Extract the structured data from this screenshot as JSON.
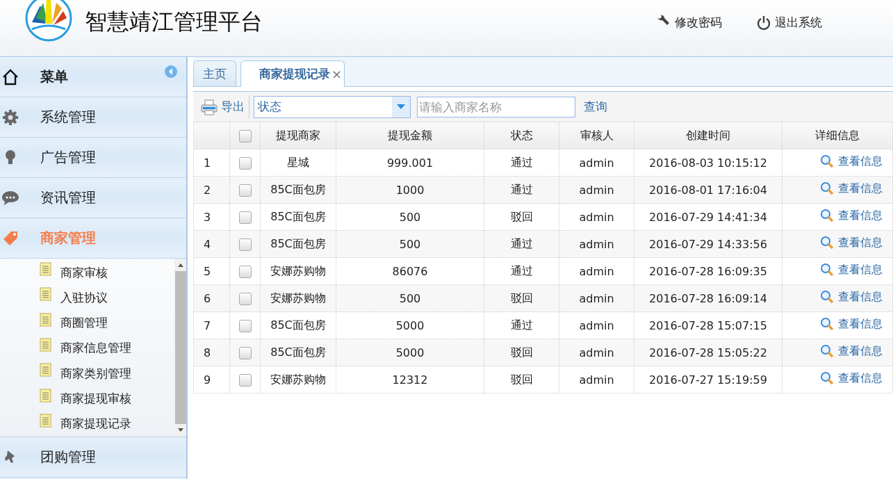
{
  "header": {
    "title": "智慧靖江管理平台",
    "actions": [
      {
        "kind": "password",
        "label": "修改密码"
      },
      {
        "kind": "logout",
        "label": "退出系统"
      }
    ]
  },
  "sidebar": {
    "title": "菜单",
    "items": [
      {
        "kind": "gear",
        "label": "系统管理",
        "selected": false
      },
      {
        "kind": "bulb",
        "label": "广告管理",
        "selected": false
      },
      {
        "kind": "chat",
        "label": "资讯管理",
        "selected": false
      },
      {
        "kind": "tag",
        "label": "商家管理",
        "selected": true,
        "children": [
          {
            "label": "商家审核"
          },
          {
            "label": "入驻协议"
          },
          {
            "label": "商圈管理"
          },
          {
            "label": "商家信息管理"
          },
          {
            "label": "商家类别管理"
          },
          {
            "label": "商家提现审核"
          },
          {
            "label": "商家提现记录"
          }
        ]
      },
      {
        "kind": "pin",
        "label": "团购管理",
        "selected": false
      }
    ]
  },
  "tabs": [
    {
      "label": "主页",
      "selected": false
    },
    {
      "label": "商家提现记录",
      "selected": true,
      "close": "×"
    }
  ],
  "toolbar": {
    "export": "导出",
    "status_select": {
      "value": "状态"
    },
    "search": {
      "placeholder": "请输入商家名称"
    },
    "query": "查询"
  },
  "table": {
    "columns": [
      "提现商家",
      "提现金额",
      "状态",
      "审核人",
      "创建时间",
      "详细信息"
    ],
    "header_checked": false,
    "rows": [
      {
        "index": "1",
        "checked": false,
        "merchant": "星城",
        "amount": "999.001",
        "status": "通过",
        "reviewer": "admin",
        "created": "2016-08-03 10:15:12",
        "detail": "查看信息"
      },
      {
        "index": "2",
        "checked": false,
        "merchant": "85C面包房",
        "amount": "1000",
        "status": "通过",
        "reviewer": "admin",
        "created": "2016-08-01 17:16:04",
        "detail": "查看信息"
      },
      {
        "index": "3",
        "checked": false,
        "merchant": "85C面包房",
        "amount": "500",
        "status": "驳回",
        "reviewer": "admin",
        "created": "2016-07-29 14:41:34",
        "detail": "查看信息"
      },
      {
        "index": "4",
        "checked": false,
        "merchant": "85C面包房",
        "amount": "500",
        "status": "通过",
        "reviewer": "admin",
        "created": "2016-07-29 14:33:56",
        "detail": "查看信息"
      },
      {
        "index": "5",
        "checked": false,
        "merchant": "安娜苏购物",
        "amount": "86076",
        "status": "通过",
        "reviewer": "admin",
        "created": "2016-07-28 16:09:35",
        "detail": "查看信息"
      },
      {
        "index": "6",
        "checked": false,
        "merchant": "安娜苏购物",
        "amount": "500",
        "status": "驳回",
        "reviewer": "admin",
        "created": "2016-07-28 16:09:14",
        "detail": "查看信息"
      },
      {
        "index": "7",
        "checked": false,
        "merchant": "85C面包房",
        "amount": "5000",
        "status": "通过",
        "reviewer": "admin",
        "created": "2016-07-28 15:07:15",
        "detail": "查看信息"
      },
      {
        "index": "8",
        "checked": false,
        "merchant": "85C面包房",
        "amount": "5000",
        "status": "驳回",
        "reviewer": "admin",
        "created": "2016-07-28 15:05:22",
        "detail": "查看信息"
      },
      {
        "index": "9",
        "checked": false,
        "merchant": "安娜苏购物",
        "amount": "12312",
        "status": "驳回",
        "reviewer": "admin",
        "created": "2016-07-27 15:19:59",
        "detail": "查看信息"
      }
    ]
  }
}
